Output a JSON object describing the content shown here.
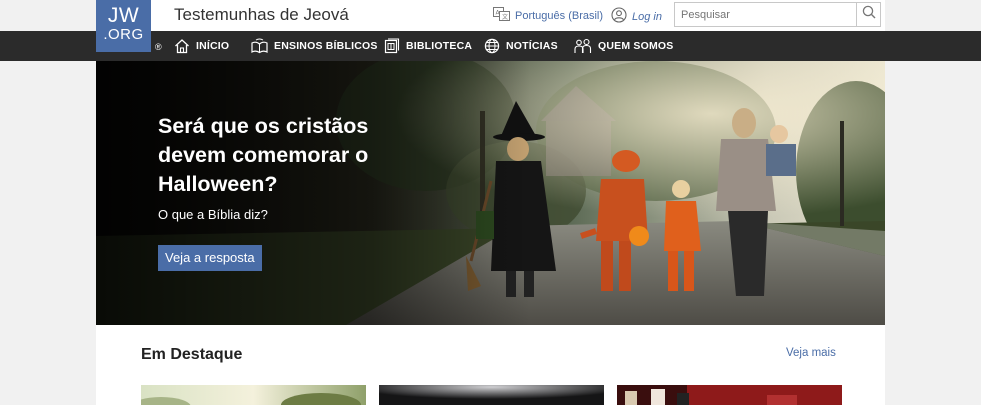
{
  "header": {
    "logo_line1": "JW",
    "logo_line2": ".ORG",
    "registered": "®",
    "site_title": "Testemunhas de Jeová",
    "language_label": "Português (Brasil)",
    "login_label": "Log in",
    "search_placeholder": "Pesquisar"
  },
  "nav": {
    "items": [
      {
        "label": "INÍCIO",
        "icon": "home-icon"
      },
      {
        "label": "ENSINOS BÍBLICOS",
        "icon": "open-book-icon"
      },
      {
        "label": "BIBLIOTECA",
        "icon": "library-icon"
      },
      {
        "label": "NOTÍCIAS",
        "icon": "globe-icon"
      },
      {
        "label": "QUEM SOMOS",
        "icon": "people-icon"
      }
    ]
  },
  "hero": {
    "title": "Será que os cristãos devem comemorar o Halloween?",
    "subtitle": "O que a Bíblia diz?",
    "button_label": "Veja a resposta"
  },
  "featured": {
    "title": "Em Destaque",
    "see_more": "Veja mais"
  },
  "colors": {
    "brand": "#4a6da7",
    "nav_bg": "#2b2b2b",
    "page_bg": "#f1f1f1"
  }
}
